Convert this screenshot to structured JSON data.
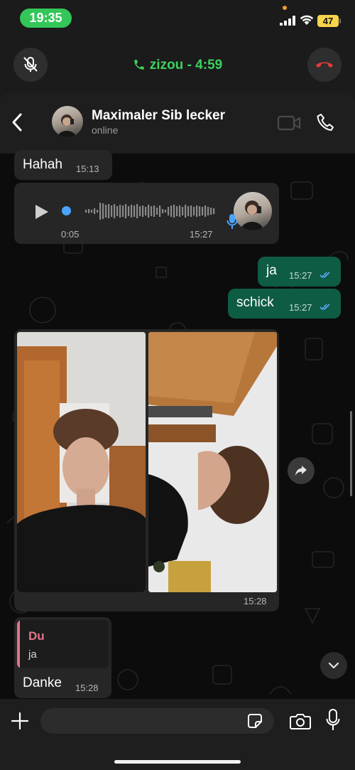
{
  "status_bar": {
    "time": "19:35",
    "battery": "47"
  },
  "call": {
    "title": "zizou - 4:59",
    "accent": "#3cd15c"
  },
  "header": {
    "name": "Maximaler Sib lecker",
    "status": "online"
  },
  "messages": [
    {
      "type": "text",
      "dir": "in",
      "text": "Hahah",
      "time": "15:13"
    },
    {
      "type": "voice",
      "dir": "in",
      "duration": "0:05",
      "time": "15:27"
    },
    {
      "type": "text",
      "dir": "out",
      "text": "ja",
      "time": "15:27",
      "read": true
    },
    {
      "type": "text",
      "dir": "out",
      "text": "schick",
      "time": "15:27",
      "read": true
    },
    {
      "type": "album",
      "dir": "in",
      "photo_count": 2,
      "time": "15:28"
    },
    {
      "type": "reply",
      "dir": "in",
      "quote_author": "Du",
      "quote_text": "ja",
      "text": "Danke",
      "time": "15:28"
    }
  ],
  "colors": {
    "bubble_in": "#262626",
    "bubble_out": "#0f5c45",
    "read_ticks": "#5aa9ff",
    "quote_author": "#e4738a"
  },
  "input": {
    "placeholder": ""
  }
}
